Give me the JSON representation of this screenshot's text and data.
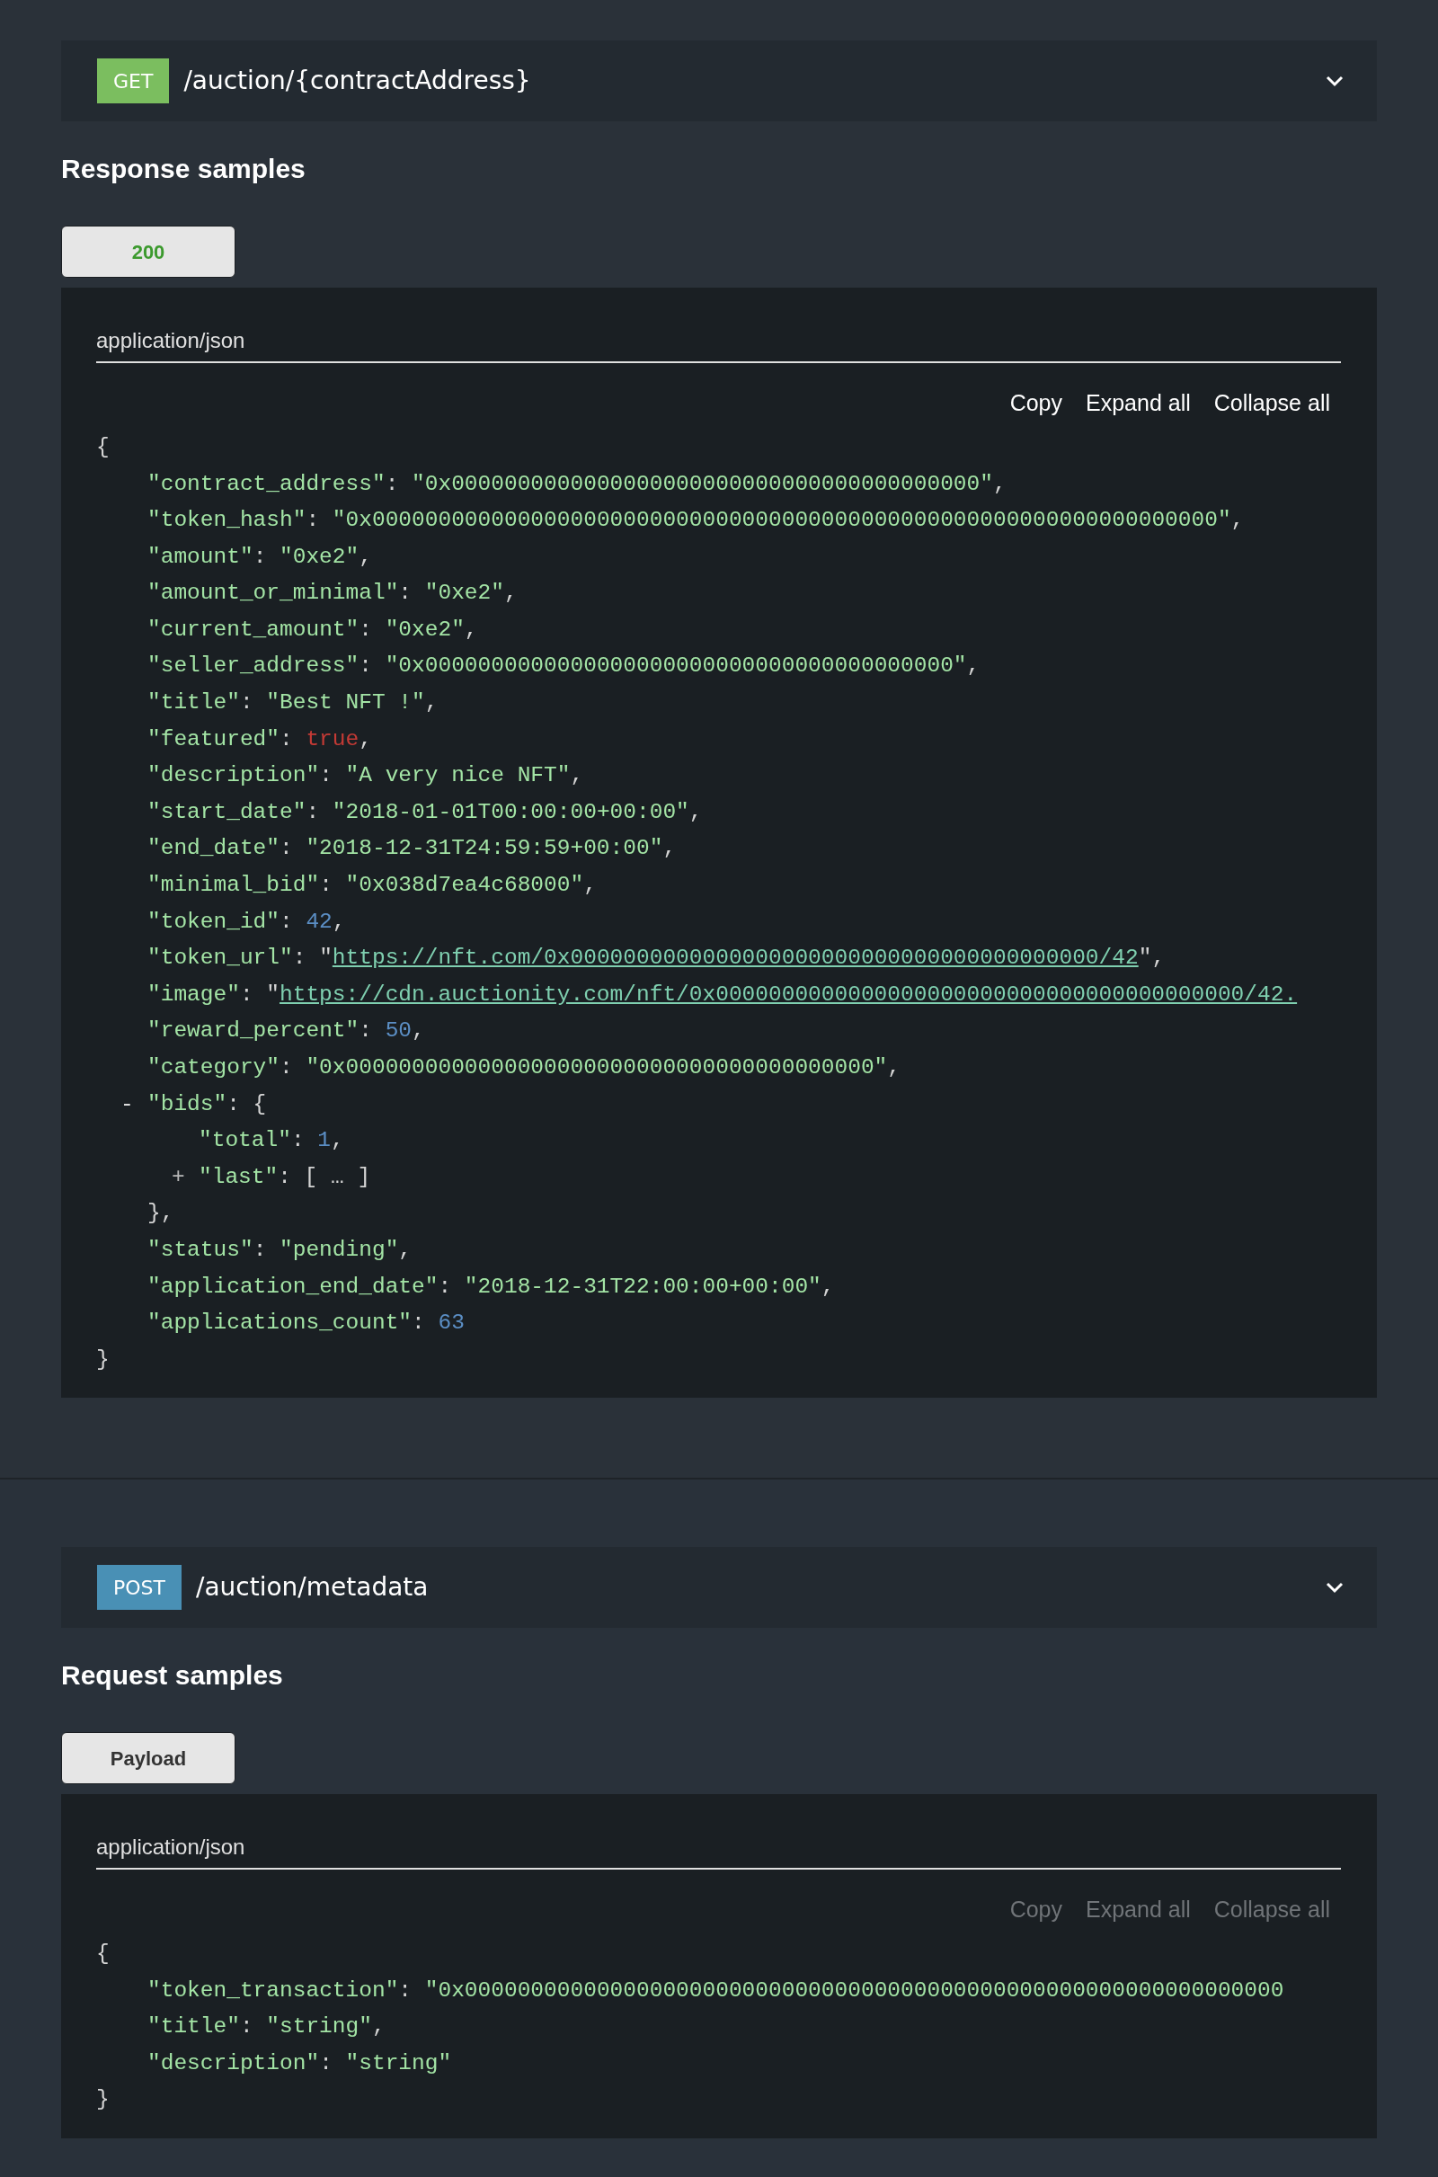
{
  "sections": [
    {
      "endpoint": {
        "kind": "get",
        "method": "GET",
        "path": "/auction/{contractAddress}"
      },
      "samples_title": "Response samples",
      "tabs": [
        {
          "label": "200",
          "kind": "success",
          "selected": true
        }
      ],
      "panel": {
        "content_type": "application/json",
        "actions": [
          {
            "label": "Copy",
            "disabled": false
          },
          {
            "label": "Expand all",
            "disabled": false
          },
          {
            "label": "Collapse all",
            "disabled": false
          }
        ],
        "open": "{",
        "entries": [
          {
            "key": "\"contract_address\"",
            "colon": ":",
            "kind": "string",
            "value": "\"0x0000000000000000000000000000000000000000\"",
            "comma": ","
          },
          {
            "key": "\"token_hash\"",
            "colon": ":",
            "kind": "string",
            "value": "\"0x0000000000000000000000000000000000000000000000000000000000000000\"",
            "comma": ","
          },
          {
            "key": "\"amount\"",
            "colon": ":",
            "kind": "string",
            "value": "\"0xe2\"",
            "comma": ","
          },
          {
            "key": "\"amount_or_minimal\"",
            "colon": ":",
            "kind": "string",
            "value": "\"0xe2\"",
            "comma": ","
          },
          {
            "key": "\"current_amount\"",
            "colon": ":",
            "kind": "string",
            "value": "\"0xe2\"",
            "comma": ","
          },
          {
            "key": "\"seller_address\"",
            "colon": ":",
            "kind": "string",
            "value": "\"0x0000000000000000000000000000000000000000\"",
            "comma": ","
          },
          {
            "key": "\"title\"",
            "colon": ":",
            "kind": "string",
            "value": "\"Best NFT !\"",
            "comma": ","
          },
          {
            "key": "\"featured\"",
            "colon": ":",
            "kind": "boolean",
            "value": "true",
            "comma": ","
          },
          {
            "key": "\"description\"",
            "colon": ":",
            "kind": "string",
            "value": "\"A very nice NFT\"",
            "comma": ","
          },
          {
            "key": "\"start_date\"",
            "colon": ":",
            "kind": "string",
            "value": "\"2018-01-01T00:00:00+00:00\"",
            "comma": ","
          },
          {
            "key": "\"end_date\"",
            "colon": ":",
            "kind": "string",
            "value": "\"2018-12-31T24:59:59+00:00\"",
            "comma": ","
          },
          {
            "key": "\"minimal_bid\"",
            "colon": ":",
            "kind": "string",
            "value": "\"0x038d7ea4c68000\"",
            "comma": ","
          },
          {
            "key": "\"token_id\"",
            "colon": ":",
            "kind": "number",
            "value": "42",
            "comma": ","
          },
          {
            "key": "\"token_url\"",
            "colon": ":",
            "kind": "link",
            "quote_open": "\"",
            "value": "https://nft.com/0x0000000000000000000000000000000000000000/42",
            "quote_close": "\"",
            "comma": ","
          },
          {
            "key": "\"image\"",
            "colon": ":",
            "kind": "link",
            "quote_open": "\"",
            "value": "https://cdn.auctionity.com/nft/0x0000000000000000000000000000000000000000/42."
          },
          {
            "key": "\"reward_percent\"",
            "colon": ":",
            "kind": "number",
            "value": "50",
            "comma": ","
          },
          {
            "key": "\"category\"",
            "colon": ":",
            "kind": "string",
            "value": "\"0x0000000000000000000000000000000000000000\"",
            "comma": ","
          },
          {
            "key": "\"bids\"",
            "colon": ":",
            "kind": "object",
            "toggle": "-",
            "expanded": true,
            "value": "{",
            "close": "},",
            "children": [
              {
                "key": "\"total\"",
                "colon": ":",
                "kind": "number",
                "value": "1",
                "comma": ","
              },
              {
                "key": "\"last\"",
                "colon": ":",
                "kind": "array",
                "toggle": "+",
                "expanded": false,
                "value": "[ … ]"
              }
            ]
          },
          {
            "key": "\"status\"",
            "colon": ":",
            "kind": "string",
            "value": "\"pending\"",
            "comma": ","
          },
          {
            "key": "\"application_end_date\"",
            "colon": ":",
            "kind": "string",
            "value": "\"2018-12-31T22:00:00+00:00\"",
            "comma": ","
          },
          {
            "key": "\"applications_count\"",
            "colon": ":",
            "kind": "number",
            "value": "63"
          }
        ],
        "close": "}"
      }
    },
    {
      "endpoint": {
        "kind": "post",
        "method": "POST",
        "path": "/auction/metadata"
      },
      "samples_title": "Request samples",
      "tabs": [
        {
          "label": "Payload",
          "kind": "plain",
          "selected": true
        }
      ],
      "panel": {
        "content_type": "application/json",
        "actions": [
          {
            "label": "Copy",
            "disabled": true
          },
          {
            "label": "Expand all",
            "disabled": true
          },
          {
            "label": "Collapse all",
            "disabled": true
          }
        ],
        "open": "{",
        "entries": [
          {
            "key": "\"token_transaction\"",
            "colon": ":",
            "kind": "string",
            "value": "\"0x00000000000000000000000000000000000000000000000000000000000000"
          },
          {
            "key": "\"title\"",
            "colon": ":",
            "kind": "string",
            "value": "\"string\"",
            "comma": ","
          },
          {
            "key": "\"description\"",
            "colon": ":",
            "kind": "string",
            "value": "\"string\""
          }
        ],
        "close": "}"
      }
    }
  ]
}
